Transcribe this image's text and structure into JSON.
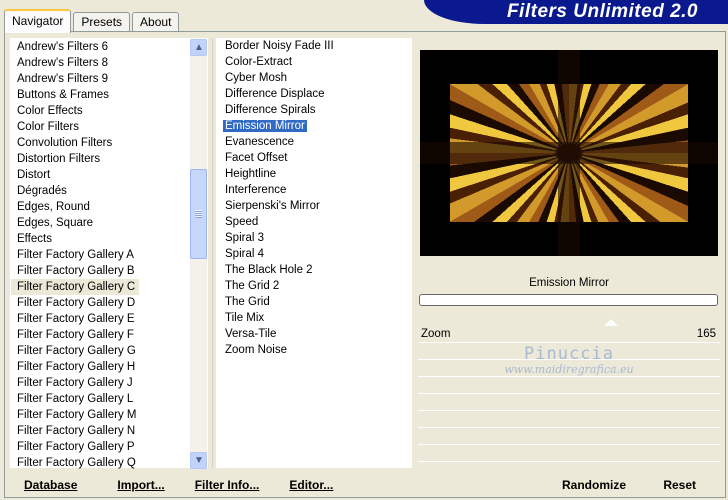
{
  "window": {
    "title": "Filters Unlimited 2.0"
  },
  "tabs": [
    {
      "label": "Navigator",
      "active": true
    },
    {
      "label": "Presets",
      "active": false
    },
    {
      "label": "About",
      "active": false
    }
  ],
  "categories": {
    "items": [
      "Andrew's Filters 6",
      "Andrew's Filters 8",
      "Andrew's Filters 9",
      "Buttons & Frames",
      "Color Effects",
      "Color Filters",
      "Convolution Filters",
      "Distortion Filters",
      "Distort",
      "Dégradés",
      "Edges, Round",
      "Edges, Square",
      "Effects",
      "Filter Factory Gallery A",
      "Filter Factory Gallery B",
      "Filter Factory Gallery C",
      "Filter Factory Gallery D",
      "Filter Factory Gallery E",
      "Filter Factory Gallery F",
      "Filter Factory Gallery G",
      "Filter Factory Gallery H",
      "Filter Factory Gallery J",
      "Filter Factory Gallery L",
      "Filter Factory Gallery M",
      "Filter Factory Gallery N",
      "Filter Factory Gallery P",
      "Filter Factory Gallery Q"
    ],
    "selected": "Filter Factory Gallery C"
  },
  "filters": {
    "items": [
      "Border Noisy Fade III",
      "Color-Extract",
      "Cyber Mosh",
      "Difference Displace",
      "Difference Spirals",
      "Emission Mirror",
      "Evanescence",
      "Facet Offset",
      "Heightline",
      "Interference",
      "Sierpenski's Mirror",
      "Speed",
      "Spiral 3",
      "Spiral 4",
      "The Black Hole 2",
      "The Grid 2",
      "The Grid",
      "Tile Mix",
      "Versa-Tile",
      "Zoom Noise"
    ],
    "selected": "Emission Mirror"
  },
  "preview": {
    "filter_name": "Emission Mirror"
  },
  "parameters": [
    {
      "label": "Zoom",
      "value": "165"
    }
  ],
  "watermark": {
    "line1": "Pinuccia",
    "line2": "www.maidiregrafica.eu"
  },
  "buttons": {
    "database": "Database",
    "import": "Import...",
    "filter_info": "Filter Info...",
    "editor": "Editor...",
    "randomize": "Randomize",
    "reset": "Reset"
  },
  "colors": {
    "selection": "#316ac5",
    "titlebar": "#0a1a8e"
  }
}
